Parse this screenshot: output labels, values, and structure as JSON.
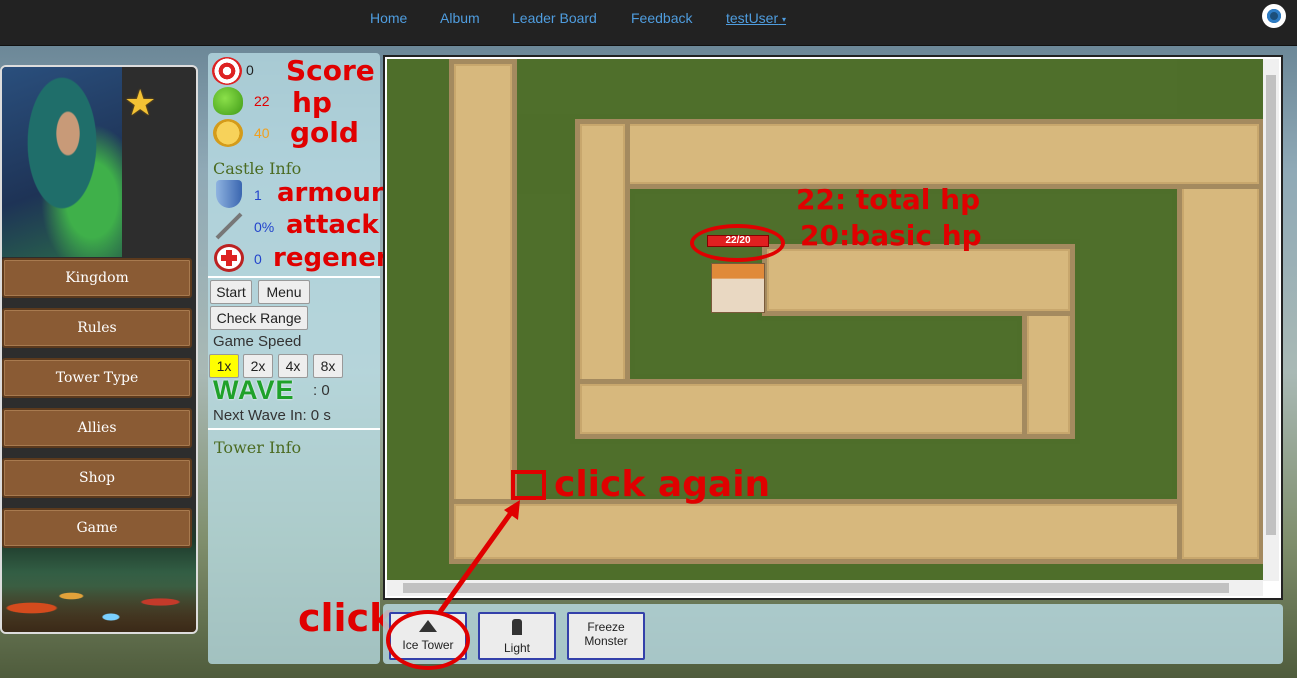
{
  "nav": {
    "home": "Home",
    "album": "Album",
    "leaderboard": "Leader Board",
    "feedback": "Feedback",
    "user": "testUser",
    "user_caret": "▾"
  },
  "sidebar": {
    "items": [
      "Kingdom",
      "Rules",
      "Tower Type",
      "Allies",
      "Shop",
      "Game"
    ]
  },
  "stats": {
    "score": "0",
    "hp": "22",
    "gold": "40",
    "castle_info_label": "Castle Info",
    "armour": "1",
    "attack_bonus": "0%",
    "regeneration": "0"
  },
  "annotations": {
    "score": "Score",
    "hp": "hp",
    "gold": "gold",
    "armour": "armour",
    "attack_bonus": "attack bonus",
    "regeneration": "regeneration",
    "total_hp": "22: total hp",
    "basic_hp": "20:basic hp",
    "click": "click",
    "click_again": "click again"
  },
  "controls": {
    "start": "Start",
    "menu": "Menu",
    "check_range": "Check Range",
    "game_speed_label": "Game Speed",
    "speeds": [
      "1x",
      "2x",
      "4x",
      "8x"
    ],
    "wave_label": "WAVE",
    "wave_value": ": 0",
    "next_wave": "Next Wave In: 0 s",
    "tower_info_label": "Tower Info"
  },
  "castle": {
    "hp_text": "22/20",
    "hp_fraction": 1.0
  },
  "towers": {
    "ice": "Ice Tower",
    "light": "Light",
    "freeze_line1": "Freeze",
    "freeze_line2": "Monster"
  },
  "colors": {
    "annotation": "#e00000",
    "link": "#4f9ddf",
    "wave": "#1fa12a",
    "speed_active": "#ffff00",
    "button_brown": "#8a5b34"
  }
}
